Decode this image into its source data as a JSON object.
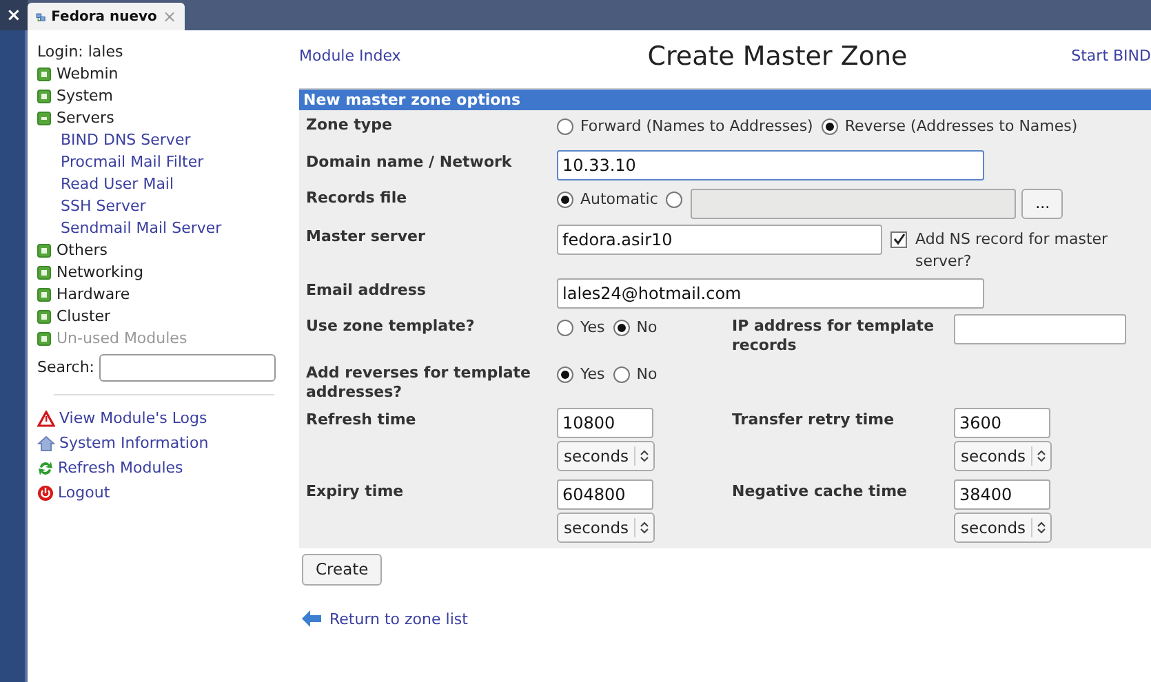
{
  "browser": {
    "close_label": "×",
    "tab": {
      "title": "Fedora nuevo",
      "close_label": "×"
    }
  },
  "sidebar": {
    "login": "Login: lales",
    "categories": [
      {
        "label": "Webmin",
        "expanded": false,
        "disabled": false
      },
      {
        "label": "System",
        "expanded": false,
        "disabled": false
      },
      {
        "label": "Servers",
        "expanded": true,
        "disabled": false,
        "children": [
          {
            "label": "BIND DNS Server"
          },
          {
            "label": "Procmail Mail Filter"
          },
          {
            "label": "Read User Mail"
          },
          {
            "label": "SSH Server"
          },
          {
            "label": "Sendmail Mail Server"
          }
        ]
      },
      {
        "label": "Others",
        "expanded": false,
        "disabled": false
      },
      {
        "label": "Networking",
        "expanded": false,
        "disabled": false
      },
      {
        "label": "Hardware",
        "expanded": false,
        "disabled": false
      },
      {
        "label": "Cluster",
        "expanded": false,
        "disabled": false
      },
      {
        "label": "Un-used Modules",
        "expanded": false,
        "disabled": true
      }
    ],
    "search": {
      "label": "Search:"
    },
    "links": [
      {
        "label": "View Module's Logs",
        "kind": "logs"
      },
      {
        "label": "System Information",
        "kind": "info"
      },
      {
        "label": "Refresh Modules",
        "kind": "refresh"
      },
      {
        "label": "Logout",
        "kind": "logout"
      }
    ]
  },
  "header": {
    "left_link": "Module Index",
    "title": "Create Master Zone",
    "right_link": "Start BIND"
  },
  "form": {
    "title": "New master zone options",
    "rows": [
      {
        "label": "Zone type",
        "controls": [
          {
            "kind": "radio",
            "options": [
              {
                "label": "Forward (Names to Addresses)",
                "selected": false
              },
              {
                "label": "Reverse (Addresses to Names)",
                "selected": true
              }
            ]
          }
        ]
      },
      {
        "label": "Domain name / Network",
        "controls": [
          {
            "kind": "text",
            "value": "10.33.10",
            "focused": true
          }
        ]
      },
      {
        "label": "Records file",
        "controls": [
          {
            "kind": "radio",
            "options": [
              {
                "label": "Automatic",
                "selected": true
              },
              {
                "selected": false
              }
            ]
          },
          {
            "kind": "text",
            "disabled": true
          },
          {
            "kind": "button",
            "label": "..."
          }
        ]
      },
      {
        "label": "Master server",
        "controls": [
          {
            "kind": "text",
            "value": "fedora.asir10"
          },
          {
            "kind": "checkbox",
            "label": "Add NS record for master server?",
            "checked": true
          }
        ]
      },
      {
        "label": "Email address",
        "controls": [
          {
            "kind": "text",
            "value": "lales24@hotmail.com"
          }
        ]
      },
      {
        "label": "Use zone template?",
        "controls": [
          {
            "kind": "radio",
            "options": [
              {
                "label": "Yes",
                "selected": false
              },
              {
                "label": "No",
                "selected": true
              }
            ]
          }
        ],
        "right": {
          "label": "IP address for template records",
          "controls": [
            {
              "kind": "text"
            }
          ]
        }
      },
      {
        "label": "Add reverses for template addresses?",
        "controls": [
          {
            "kind": "radio",
            "options": [
              {
                "label": "Yes",
                "selected": true
              },
              {
                "label": "No",
                "selected": false
              }
            ]
          }
        ]
      },
      {
        "label": "Refresh time",
        "controls": [
          {
            "kind": "duration",
            "value": "10800",
            "unit": "seconds"
          }
        ],
        "right": {
          "label": "Transfer retry time",
          "controls": [
            {
              "kind": "duration",
              "value": "3600",
              "unit": "seconds"
            }
          ]
        }
      },
      {
        "label": "Expiry time",
        "controls": [
          {
            "kind": "duration",
            "value": "604800",
            "unit": "seconds"
          }
        ],
        "right": {
          "label": "Negative cache time",
          "controls": [
            {
              "kind": "duration",
              "value": "38400",
              "unit": "seconds"
            }
          ]
        }
      }
    ],
    "submit": "Create"
  },
  "return_link": "Return to zone list"
}
